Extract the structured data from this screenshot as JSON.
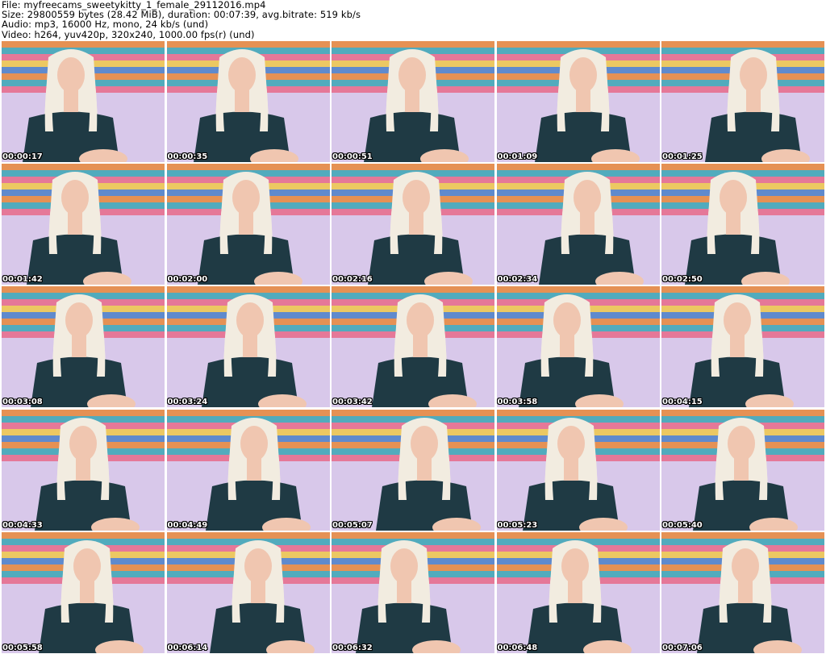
{
  "header": {
    "file_line": "File: myfreecams_sweetykitty_1_female_29112016.mp4",
    "size_line": "Size: 29800559 bytes (28.42 MiB), duration: 00:07:39, avg.bitrate: 519 kb/s",
    "audio_line": "Audio: mp3, 16000 Hz, mono, 24 kb/s (und)",
    "video_line": "Video: h264, yuv420p, 320x240, 1000.00 fps(r) (und)"
  },
  "frames": [
    {
      "timestamp": "00:00:17"
    },
    {
      "timestamp": "00:00:35"
    },
    {
      "timestamp": "00:00:51"
    },
    {
      "timestamp": "00:01:09"
    },
    {
      "timestamp": "00:01:25"
    },
    {
      "timestamp": "00:01:42"
    },
    {
      "timestamp": "00:02:00"
    },
    {
      "timestamp": "00:02:16"
    },
    {
      "timestamp": "00:02:34"
    },
    {
      "timestamp": "00:02:50"
    },
    {
      "timestamp": "00:03:08"
    },
    {
      "timestamp": "00:03:24"
    },
    {
      "timestamp": "00:03:42"
    },
    {
      "timestamp": "00:03:58"
    },
    {
      "timestamp": "00:04:15"
    },
    {
      "timestamp": "00:04:33"
    },
    {
      "timestamp": "00:04:49"
    },
    {
      "timestamp": "00:05:07"
    },
    {
      "timestamp": "00:05:23"
    },
    {
      "timestamp": "00:05:40"
    },
    {
      "timestamp": "00:05:58"
    },
    {
      "timestamp": "00:06:14"
    },
    {
      "timestamp": "00:06:32"
    },
    {
      "timestamp": "00:06:48"
    },
    {
      "timestamp": "00:07:06"
    }
  ],
  "colors": {
    "background_wall": "#d8c8ea",
    "stripe_orange": "#e8873a",
    "stripe_teal": "#3aa6b5",
    "stripe_pink": "#e86a8a",
    "stripe_yellow": "#f0c84a",
    "stripe_blue": "#4a7fc8",
    "hair": "#f2ece0",
    "skin": "#f0c6b0",
    "shirt": "#1f3a44"
  }
}
